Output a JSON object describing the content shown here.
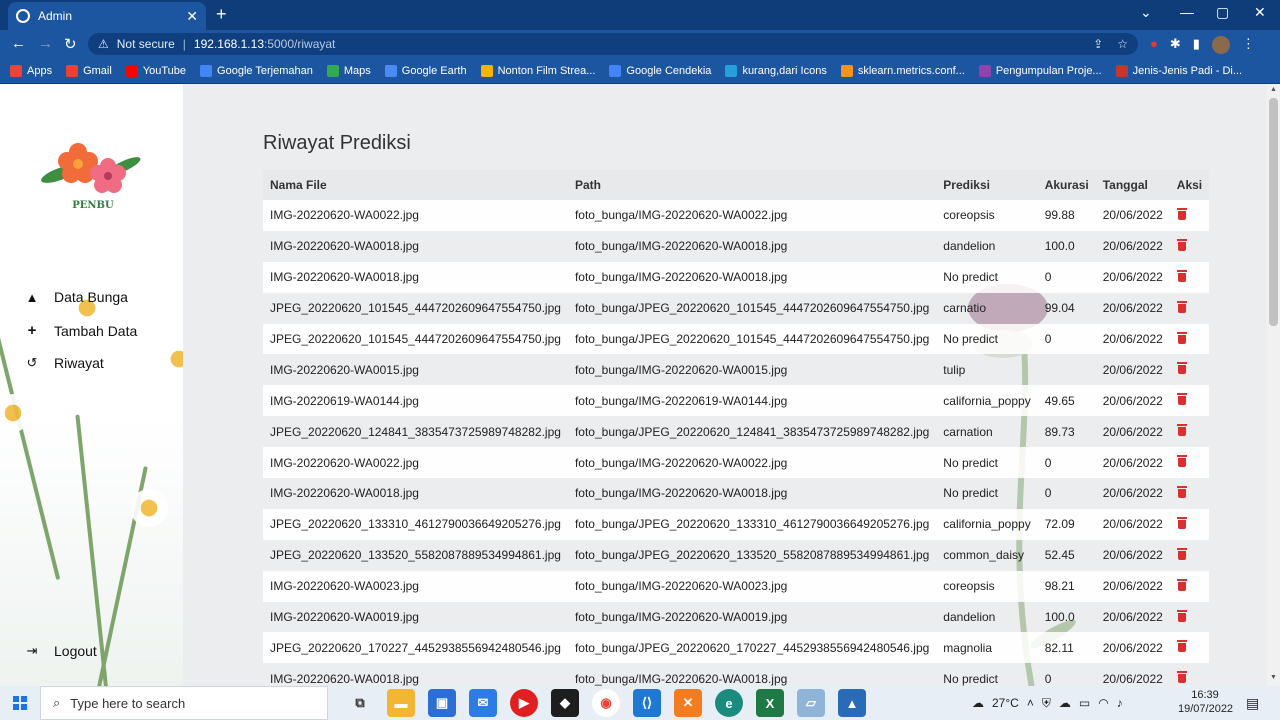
{
  "browser": {
    "tab_title": "Admin",
    "address": {
      "security": "Not secure",
      "host": "192.168.1.13",
      "path": ":5000/riwayat"
    },
    "bookmarks": [
      {
        "label": "Apps",
        "color": "#e8453c"
      },
      {
        "label": "Gmail",
        "color": "#ea4335"
      },
      {
        "label": "YouTube",
        "color": "#ff0000"
      },
      {
        "label": "Google Terjemahan",
        "color": "#4285f4"
      },
      {
        "label": "Maps",
        "color": "#34a853"
      },
      {
        "label": "Google Earth",
        "color": "#4a8af4"
      },
      {
        "label": "Nonton Film Strea...",
        "color": "#f4b400"
      },
      {
        "label": "Google Cendekia",
        "color": "#4285f4"
      },
      {
        "label": "kurang,dari Icons",
        "color": "#26a0da"
      },
      {
        "label": "sklearn.metrics.conf...",
        "color": "#f7931e"
      },
      {
        "label": "Pengumpulan Proje...",
        "color": "#8e44ad"
      },
      {
        "label": "Jenis-Jenis Padi - Di...",
        "color": "#c0392b"
      }
    ]
  },
  "sidebar": {
    "logo_text": "PENBU",
    "items": [
      {
        "label": "Data Bunga",
        "icon": "tree-icon"
      },
      {
        "label": "Tambah Data",
        "icon": "plus-icon"
      },
      {
        "label": "Riwayat",
        "icon": "history-icon"
      }
    ],
    "logout": "Logout"
  },
  "main": {
    "title": "Riwayat Prediksi",
    "columns": [
      "Nama File",
      "Path",
      "Prediksi",
      "Akurasi",
      "Tanggal",
      "Aksi"
    ],
    "rows": [
      [
        "IMG-20220620-WA0022.jpg",
        "foto_bunga/IMG-20220620-WA0022.jpg",
        "coreopsis",
        "99.88",
        "20/06/2022"
      ],
      [
        "IMG-20220620-WA0018.jpg",
        "foto_bunga/IMG-20220620-WA0018.jpg",
        "dandelion",
        "100.0",
        "20/06/2022"
      ],
      [
        "IMG-20220620-WA0018.jpg",
        "foto_bunga/IMG-20220620-WA0018.jpg",
        "No predict",
        "0",
        "20/06/2022"
      ],
      [
        "JPEG_20220620_101545_4447202609647554750.jpg",
        "foto_bunga/JPEG_20220620_101545_4447202609647554750.jpg",
        "carnatio",
        "99.04",
        "20/06/2022"
      ],
      [
        "JPEG_20220620_101545_4447202609647554750.jpg",
        "foto_bunga/JPEG_20220620_101545_4447202609647554750.jpg",
        "No predict",
        "0",
        "20/06/2022"
      ],
      [
        "IMG-20220620-WA0015.jpg",
        "foto_bunga/IMG-20220620-WA0015.jpg",
        "tulip",
        "",
        "20/06/2022"
      ],
      [
        "IMG-20220619-WA0144.jpg",
        "foto_bunga/IMG-20220619-WA0144.jpg",
        "california_poppy",
        "49.65",
        "20/06/2022"
      ],
      [
        "JPEG_20220620_124841_3835473725989748282.jpg",
        "foto_bunga/JPEG_20220620_124841_3835473725989748282.jpg",
        "carnation",
        "89.73",
        "20/06/2022"
      ],
      [
        "IMG-20220620-WA0022.jpg",
        "foto_bunga/IMG-20220620-WA0022.jpg",
        "No predict",
        "0",
        "20/06/2022"
      ],
      [
        "IMG-20220620-WA0018.jpg",
        "foto_bunga/IMG-20220620-WA0018.jpg",
        "No predict",
        "0",
        "20/06/2022"
      ],
      [
        "JPEG_20220620_133310_4612790036649205276.jpg",
        "foto_bunga/JPEG_20220620_133310_4612790036649205276.jpg",
        "california_poppy",
        "72.09",
        "20/06/2022"
      ],
      [
        "JPEG_20220620_133520_5582087889534994861.jpg",
        "foto_bunga/JPEG_20220620_133520_5582087889534994861.jpg",
        "common_daisy",
        "52.45",
        "20/06/2022"
      ],
      [
        "IMG-20220620-WA0023.jpg",
        "foto_bunga/IMG-20220620-WA0023.jpg",
        "coreopsis",
        "98.21",
        "20/06/2022"
      ],
      [
        "IMG-20220620-WA0019.jpg",
        "foto_bunga/IMG-20220620-WA0019.jpg",
        "dandelion",
        "100.0",
        "20/06/2022"
      ],
      [
        "JPEG_20220620_170227_4452938556942480546.jpg",
        "foto_bunga/JPEG_20220620_170227_4452938556942480546.jpg",
        "magnolia",
        "82.11",
        "20/06/2022"
      ],
      [
        "IMG-20220620-WA0018.jpg",
        "foto_bunga/IMG-20220620-WA0018.jpg",
        "No predict",
        "0",
        "20/06/2022"
      ]
    ]
  },
  "taskbar": {
    "search_placeholder": "Type here to search",
    "temperature": "27°C",
    "time": "16:39",
    "date": "19/07/2022"
  }
}
